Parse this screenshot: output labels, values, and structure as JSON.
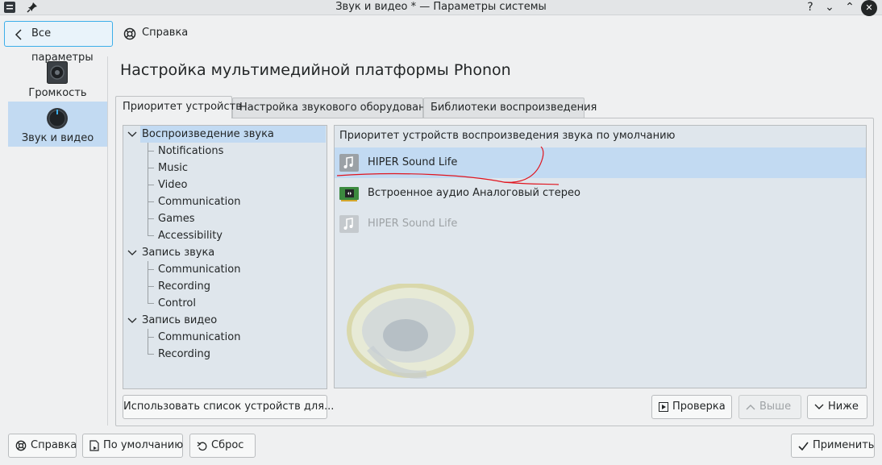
{
  "window": {
    "title": "Звук и видео * — Параметры системы",
    "controls": [
      "?",
      "⌄",
      "⌃",
      "✕"
    ]
  },
  "toolbar": {
    "back_label": "Все параметры",
    "help_label": "Справка"
  },
  "sidebar": {
    "items": [
      {
        "label": "Громкость",
        "icon": "speaker-icon"
      },
      {
        "label": "Звук и видео",
        "icon": "knob-icon"
      }
    ]
  },
  "page": {
    "heading": "Настройка мультимедийной платформы Phonon"
  },
  "tabs": [
    {
      "label": "Приоритет устройств"
    },
    {
      "label": "Настройка звукового оборудования"
    },
    {
      "label": "Библиотеки воспроизведения"
    }
  ],
  "tree": {
    "groups": [
      {
        "label": "Воспроизведение звука",
        "children": [
          "Notifications",
          "Music",
          "Video",
          "Communication",
          "Games",
          "Accessibility"
        ]
      },
      {
        "label": "Запись звука",
        "children": [
          "Communication",
          "Recording",
          "Control"
        ]
      },
      {
        "label": "Запись видео",
        "children": [
          "Communication",
          "Recording"
        ]
      }
    ]
  },
  "devices": {
    "header": "Приоритет устройств воспроизведения звука по умолчанию",
    "items": [
      {
        "name": "HIPER Sound Life"
      },
      {
        "name": "Встроенное аудио Аналоговый стерео"
      },
      {
        "name": "HIPER Sound Life"
      }
    ]
  },
  "buttons": {
    "use_list": "Использовать список устройств для...",
    "test": "Проверка",
    "up": "Выше",
    "down": "Ниже",
    "help": "Справка",
    "defaults": "По умолчанию",
    "reset": "Сброс",
    "apply": "Применить"
  },
  "colors": {
    "selection": "#c2daf2",
    "annotation": "#e0141e"
  }
}
